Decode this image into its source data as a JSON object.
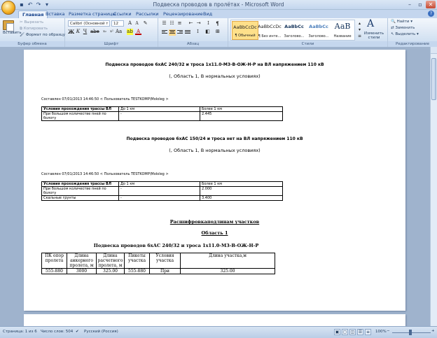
{
  "window": {
    "title": "Подвеска проводов в пролётах - Microsoft Word"
  },
  "tabs": [
    {
      "label": "Главная"
    },
    {
      "label": "Вставка"
    },
    {
      "label": "Разметка страницы"
    },
    {
      "label": "Ссылки"
    },
    {
      "label": "Рассылки"
    },
    {
      "label": "Рецензирование"
    },
    {
      "label": "Вид"
    }
  ],
  "ribbon": {
    "clipboard": {
      "paste": "Вставить",
      "cut": "Вырезать",
      "copy": "Копировать",
      "format_painter": "Формат по образцу",
      "label": "Буфер обмена"
    },
    "font": {
      "name": "Calibri (Основной т",
      "size": "12",
      "label": "Шрифт"
    },
    "paragraph": {
      "label": "Абзац"
    },
    "styles": {
      "label": "Стили",
      "items": [
        {
          "sample": "AaBbCcDc",
          "name": "¶ Обычный"
        },
        {
          "sample": "AaBbCcDc",
          "name": "¶ Без инте..."
        },
        {
          "sample": "AaBbCc",
          "name": "Заголово..."
        },
        {
          "sample": "AaBbCc",
          "name": "Заголово..."
        },
        {
          "sample": "АаВ",
          "name": "Название"
        }
      ],
      "change_styles": "Изменить стили"
    },
    "editing": {
      "find": "Найти",
      "replace": "Заменить",
      "select": "Выделить",
      "label": "Редактирование"
    }
  },
  "document": {
    "section1": {
      "heading": "Подвеска проводов 6хАС 240/32 и троса 1х11.0-М3-В-ОЖ-Н-Р на ВЛ напряжением 110 кВ",
      "sub": "(, Область 1, В нормальных условиях)",
      "meta": "Составлен 07/01/2013 14:46:50 < Пользователь TESTKOMP\\Mololeg >",
      "table": {
        "headers": [
          "Условия прохождения трассы ВЛ",
          "До 1 км",
          "Более 1 км"
        ],
        "rows": [
          [
            "При большом количестве пней по болоту",
            "-",
            "2.445"
          ]
        ]
      }
    },
    "section2": {
      "heading": "Подвеска проводов 6хАС 150/24 и троса нет на ВЛ напряжением 110 кВ",
      "sub": "(, Область 1, В нормальных условиях)",
      "meta": "Составлен 07/01/2013 14:46:50 < Пользователь TESTKOMP\\Mololeg >",
      "table": {
        "headers": [
          "Условия прохождения трассы ВЛ",
          "До 1 км",
          "Более 1 км"
        ],
        "rows": [
          [
            "При большом количестве пней по болоту",
            "-",
            "2.000"
          ],
          [
            "Скальные грунты",
            "-",
            "3.400"
          ]
        ]
      }
    },
    "breakdown": {
      "title": "Расшифровкаподлинам участков",
      "area": "Область 1",
      "heading": "Подвеска проводов 6хАС 240/32 и троса 1х11.0-М3-В-ОЖ-Н-Р",
      "table": {
        "headers": [
          "ПК опор пролета",
          "Длина анкерного пролета, м",
          "Длина расчетного пролета, м",
          "Пикеты участка",
          "Условия участка",
          "Длина участка,м"
        ],
        "rows": [
          [
            "555-880",
            "3000",
            "325.00",
            "555-880",
            "При",
            "325.00"
          ]
        ]
      }
    }
  },
  "status": {
    "page": "Страница: 1 из 6",
    "words": "Число слов: 504",
    "language": "Русский (Россия)",
    "zoom": "100%"
  }
}
